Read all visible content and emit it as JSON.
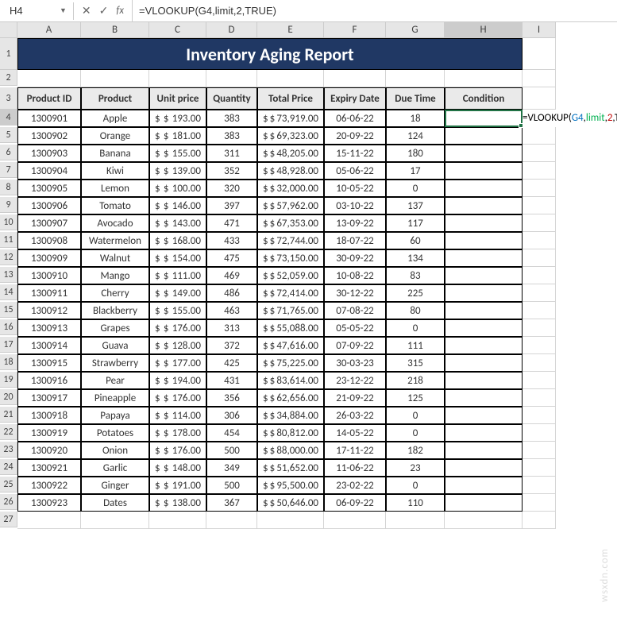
{
  "name_box": "H4",
  "formula_bar": "=VLOOKUP(G4,limit,2,TRUE)",
  "title": "Inventory Aging Report",
  "columns": [
    "A",
    "B",
    "C",
    "D",
    "E",
    "F",
    "G",
    "H",
    "I"
  ],
  "headers": [
    "Product ID",
    "Product",
    "Unit price",
    "Quantity",
    "Total Price",
    "Expiry Date",
    "Due Time",
    "Condition"
  ],
  "rows": [
    {
      "id": "1300901",
      "prod": "Apple",
      "unit": "193.00",
      "qty": "383",
      "total": "73,919.00",
      "exp": "06-06-22",
      "due": "18",
      "cond": ""
    },
    {
      "id": "1300902",
      "prod": "Orange",
      "unit": "181.00",
      "qty": "383",
      "total": "69,323.00",
      "exp": "20-09-22",
      "due": "124",
      "cond": ""
    },
    {
      "id": "1300903",
      "prod": "Banana",
      "unit": "155.00",
      "qty": "311",
      "total": "48,205.00",
      "exp": "15-11-22",
      "due": "180",
      "cond": ""
    },
    {
      "id": "1300904",
      "prod": "Kiwi",
      "unit": "139.00",
      "qty": "352",
      "total": "48,928.00",
      "exp": "05-06-22",
      "due": "17",
      "cond": ""
    },
    {
      "id": "1300905",
      "prod": "Lemon",
      "unit": "100.00",
      "qty": "320",
      "total": "32,000.00",
      "exp": "10-05-22",
      "due": "0",
      "cond": ""
    },
    {
      "id": "1300906",
      "prod": "Tomato",
      "unit": "146.00",
      "qty": "397",
      "total": "57,962.00",
      "exp": "03-10-22",
      "due": "137",
      "cond": ""
    },
    {
      "id": "1300907",
      "prod": "Avocado",
      "unit": "143.00",
      "qty": "471",
      "total": "67,353.00",
      "exp": "13-09-22",
      "due": "117",
      "cond": ""
    },
    {
      "id": "1300908",
      "prod": "Watermelon",
      "unit": "168.00",
      "qty": "433",
      "total": "72,744.00",
      "exp": "18-07-22",
      "due": "60",
      "cond": ""
    },
    {
      "id": "1300909",
      "prod": "Walnut",
      "unit": "154.00",
      "qty": "475",
      "total": "73,150.00",
      "exp": "30-09-22",
      "due": "134",
      "cond": ""
    },
    {
      "id": "1300910",
      "prod": "Mango",
      "unit": "111.00",
      "qty": "469",
      "total": "52,059.00",
      "exp": "10-08-22",
      "due": "83",
      "cond": ""
    },
    {
      "id": "1300911",
      "prod": "Cherry",
      "unit": "149.00",
      "qty": "486",
      "total": "72,414.00",
      "exp": "30-12-22",
      "due": "225",
      "cond": ""
    },
    {
      "id": "1300912",
      "prod": "Blackberry",
      "unit": "155.00",
      "qty": "463",
      "total": "71,765.00",
      "exp": "07-08-22",
      "due": "80",
      "cond": ""
    },
    {
      "id": "1300913",
      "prod": "Grapes",
      "unit": "176.00",
      "qty": "313",
      "total": "55,088.00",
      "exp": "05-05-22",
      "due": "0",
      "cond": ""
    },
    {
      "id": "1300914",
      "prod": "Guava",
      "unit": "128.00",
      "qty": "372",
      "total": "47,616.00",
      "exp": "07-09-22",
      "due": "111",
      "cond": ""
    },
    {
      "id": "1300915",
      "prod": "Strawberry",
      "unit": "177.00",
      "qty": "425",
      "total": "75,225.00",
      "exp": "30-03-23",
      "due": "315",
      "cond": ""
    },
    {
      "id": "1300916",
      "prod": "Pear",
      "unit": "194.00",
      "qty": "431",
      "total": "83,614.00",
      "exp": "23-12-22",
      "due": "218",
      "cond": ""
    },
    {
      "id": "1300917",
      "prod": "Pineapple",
      "unit": "176.00",
      "qty": "356",
      "total": "62,656.00",
      "exp": "21-09-22",
      "due": "125",
      "cond": ""
    },
    {
      "id": "1300918",
      "prod": "Papaya",
      "unit": "114.00",
      "qty": "306",
      "total": "34,884.00",
      "exp": "26-03-22",
      "due": "0",
      "cond": ""
    },
    {
      "id": "1300919",
      "prod": "Potatoes",
      "unit": "178.00",
      "qty": "454",
      "total": "80,812.00",
      "exp": "14-05-22",
      "due": "0",
      "cond": ""
    },
    {
      "id": "1300920",
      "prod": "Onion",
      "unit": "176.00",
      "qty": "500",
      "total": "88,000.00",
      "exp": "17-11-22",
      "due": "182",
      "cond": ""
    },
    {
      "id": "1300921",
      "prod": "Garlic",
      "unit": "148.00",
      "qty": "349",
      "total": "51,652.00",
      "exp": "11-06-22",
      "due": "23",
      "cond": ""
    },
    {
      "id": "1300922",
      "prod": "Ginger",
      "unit": "191.00",
      "qty": "500",
      "total": "95,500.00",
      "exp": "23-02-22",
      "due": "0",
      "cond": ""
    },
    {
      "id": "1300923",
      "prod": "Dates",
      "unit": "138.00",
      "qty": "367",
      "total": "50,646.00",
      "exp": "06-09-22",
      "due": "110",
      "cond": ""
    }
  ],
  "watermark": "wsxdn.com",
  "formula_overflow": {
    "p1": "=VLOOKUP(",
    "p2": "G4",
    "p3": ",",
    "p4": "limit",
    "p5": ",",
    "p6": "2",
    "p7": ",TRUE)"
  }
}
